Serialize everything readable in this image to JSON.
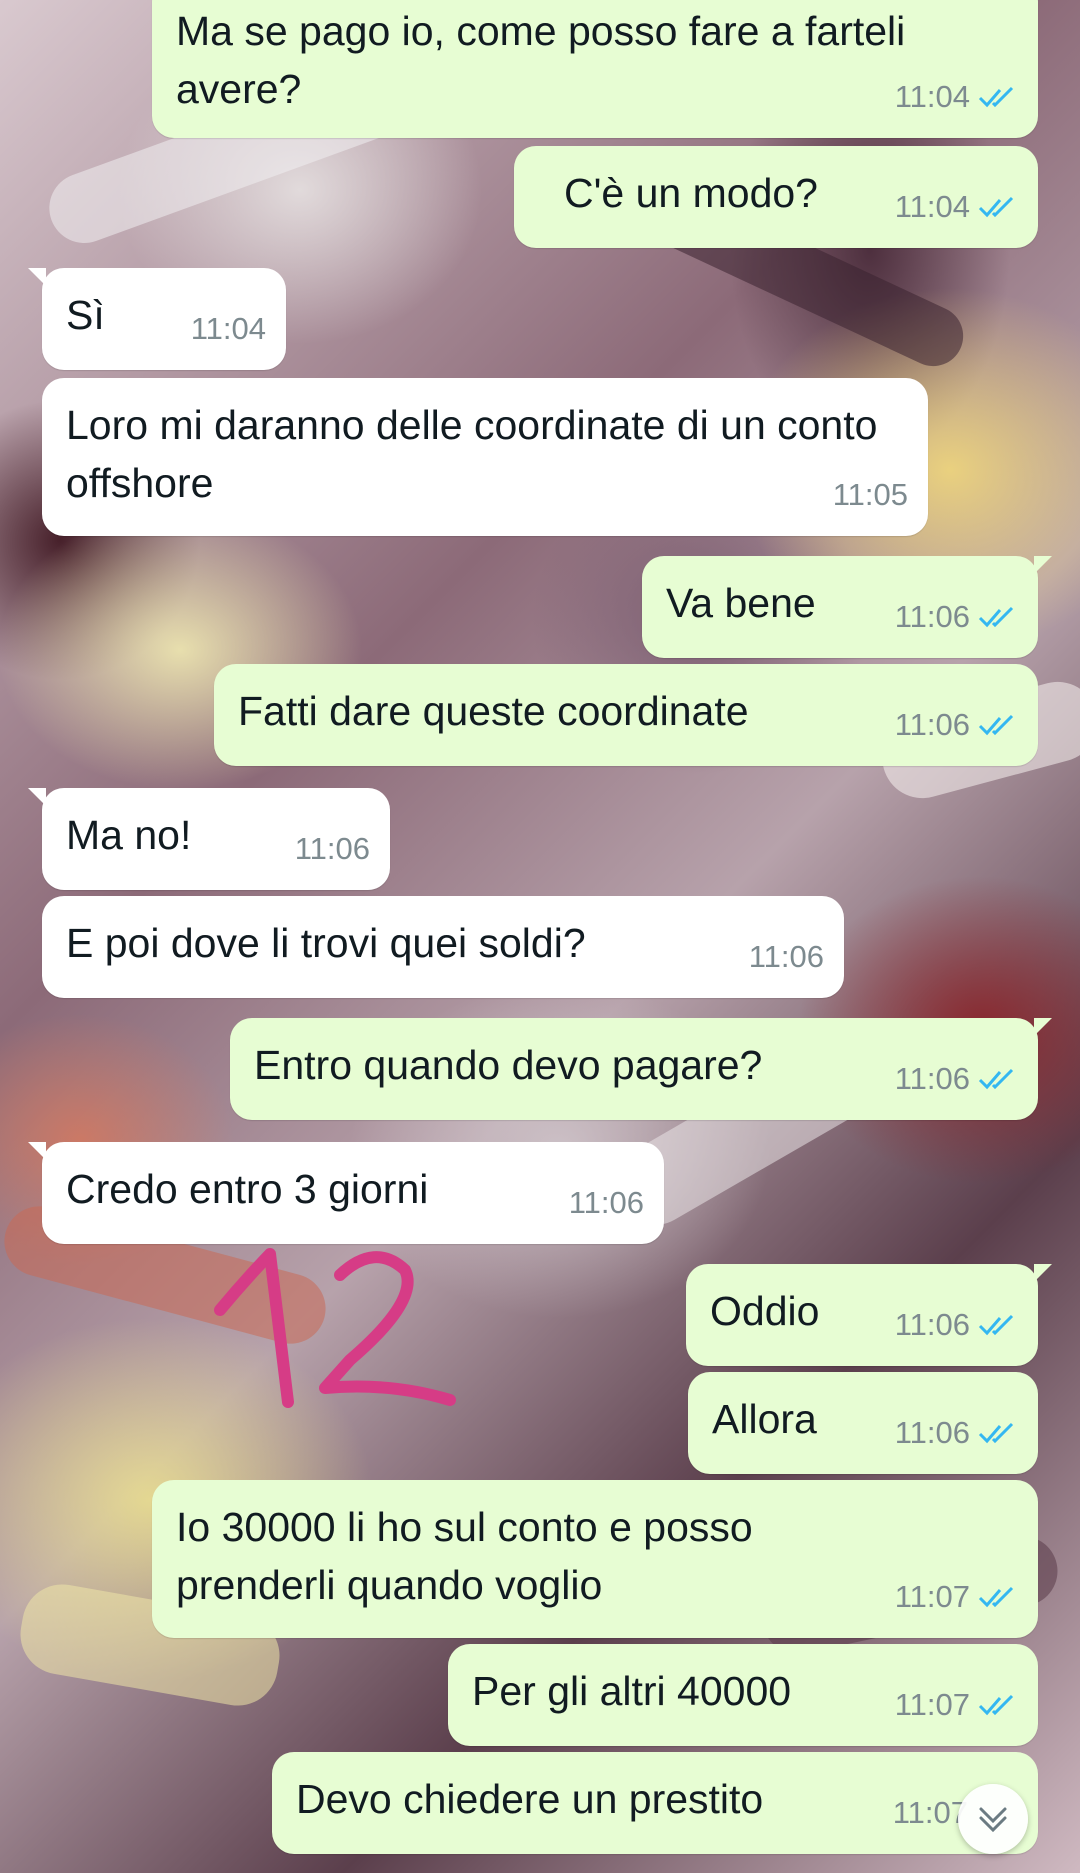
{
  "colors": {
    "outgoing_bubble": "#e7fdd3",
    "incoming_bubble": "#ffffff",
    "read_ticks": "#34b7f1",
    "timestamp": "#7d8a8f",
    "annotation_ink": "#d63c86"
  },
  "messages": [
    {
      "side": "out",
      "text": "Ma se pago io, come posso fare a farteli avere?",
      "time": "11:04",
      "status": "read"
    },
    {
      "side": "out",
      "text": "C'è un modo?",
      "time": "11:04",
      "status": "read"
    },
    {
      "side": "in",
      "text": "Sì",
      "time": "11:04"
    },
    {
      "side": "in",
      "text": "Loro mi daranno delle coordinate di un conto offshore",
      "time": "11:05"
    },
    {
      "side": "out",
      "text": "Va bene",
      "time": "11:06",
      "status": "read"
    },
    {
      "side": "out",
      "text": "Fatti dare queste coordinate",
      "time": "11:06",
      "status": "read"
    },
    {
      "side": "in",
      "text": "Ma no!",
      "time": "11:06"
    },
    {
      "side": "in",
      "text": "E poi dove li trovi quei soldi?",
      "time": "11:06"
    },
    {
      "side": "out",
      "text": "Entro quando devo pagare?",
      "time": "11:06",
      "status": "read"
    },
    {
      "side": "in",
      "text": "Credo entro 3 giorni",
      "time": "11:06"
    },
    {
      "side": "out",
      "text": "Oddio",
      "time": "11:06",
      "status": "read"
    },
    {
      "side": "out",
      "text": "Allora",
      "time": "11:06",
      "status": "read"
    },
    {
      "side": "out",
      "text": "Io 30000 li ho sul conto e posso prenderli quando voglio",
      "time": "11:07",
      "status": "read"
    },
    {
      "side": "out",
      "text": "Per gli altri 40000",
      "time": "11:07",
      "status": "read"
    },
    {
      "side": "out",
      "text": "Devo chiedere un prestito",
      "time": "11:07",
      "status": "read"
    }
  ],
  "annotation": {
    "text": "12"
  },
  "scroll_button": {
    "icon": "double-chevron-down-icon"
  }
}
